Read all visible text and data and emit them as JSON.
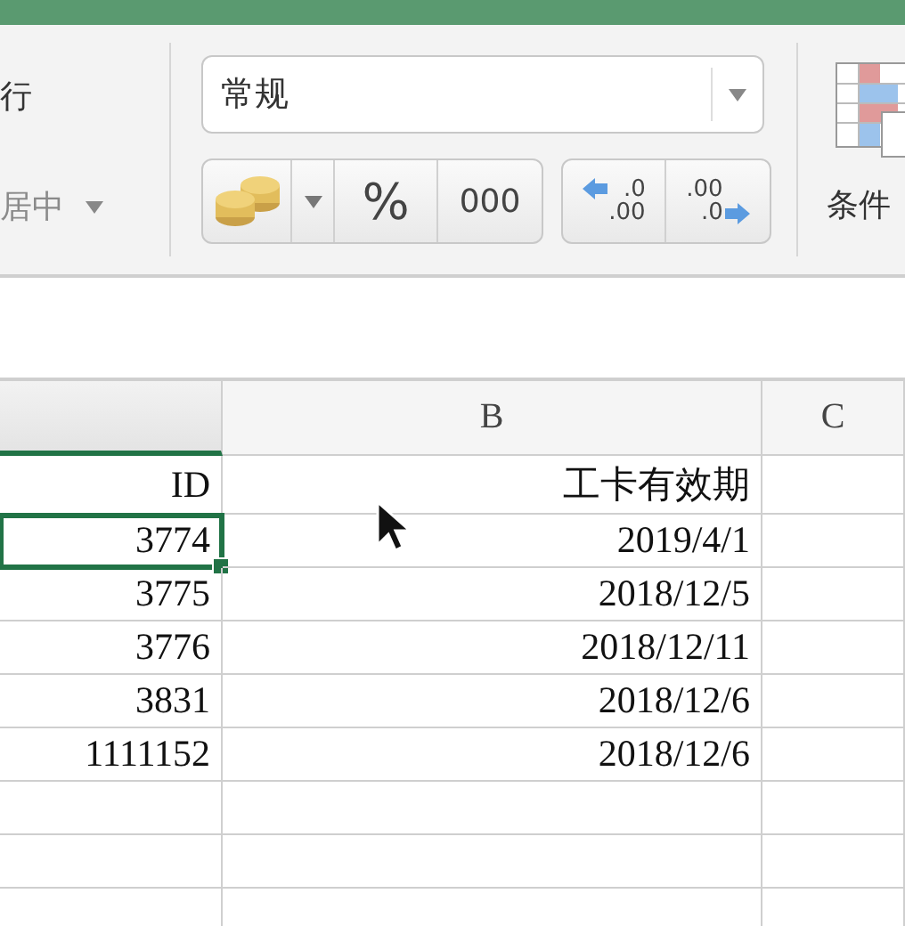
{
  "ribbon": {
    "wrap_label": "行",
    "merge_label": "居中",
    "number_format": {
      "value": "常规"
    },
    "number_buttons": [
      {
        "kind": "currency"
      },
      {
        "kind": "percent",
        "label": "%"
      },
      {
        "kind": "thousands",
        "label": "000"
      }
    ],
    "decimal_buttons": [
      {
        "kind": "increase",
        "top": ".0",
        "bottom": ".00"
      },
      {
        "kind": "decrease",
        "top": ".00",
        "bottom": ".0"
      }
    ],
    "conditional_label": "条件"
  },
  "grid": {
    "columns": [
      {
        "selected": true
      },
      {
        "label": "B",
        "selected": false
      },
      {
        "label": "C",
        "selected": false
      }
    ],
    "rows": [
      {
        "id": "ID",
        "date": "工卡有效期",
        "selected": false
      },
      {
        "id": "3774",
        "date": "2019/4/1",
        "selected": true
      },
      {
        "id": "3775",
        "date": "2018/12/5",
        "selected": false
      },
      {
        "id": "3776",
        "date": "2018/12/11",
        "selected": false
      },
      {
        "id": "3831",
        "date": "2018/12/6",
        "selected": false
      },
      {
        "id": "1111152",
        "date": "2018/12/6",
        "selected": false
      }
    ]
  }
}
